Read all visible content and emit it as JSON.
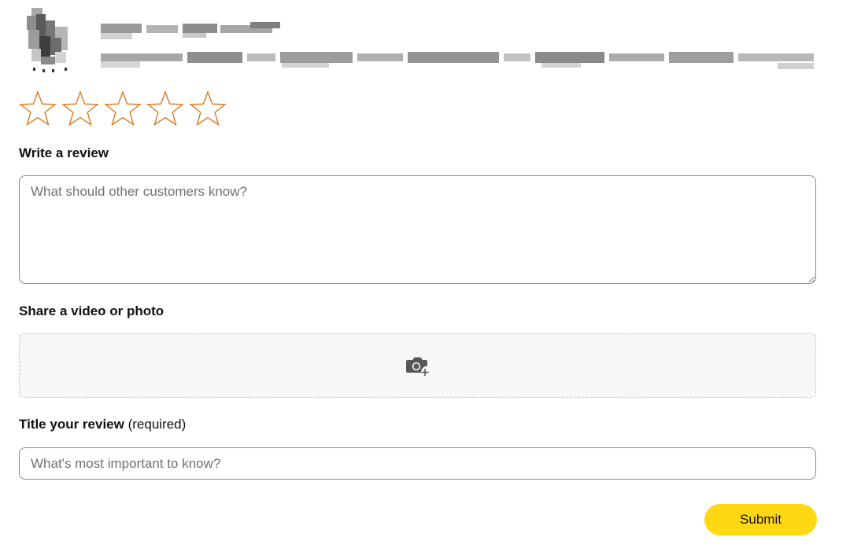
{
  "product": {
    "thumbnail": "blurred-product-image",
    "title": "",
    "description": ""
  },
  "rating": {
    "max_stars": 5,
    "selected": 0,
    "star_color": "#de7921"
  },
  "review": {
    "label": "Write a review",
    "placeholder": "What should other customers know?",
    "value": ""
  },
  "media": {
    "label": "Share a video or photo",
    "icon": "camera-plus-icon"
  },
  "title_field": {
    "label": "Title your review",
    "required_note": "(required)",
    "placeholder": "What's most important to know?",
    "value": ""
  },
  "submit": {
    "label": "Submit",
    "color": "#ffd814"
  }
}
